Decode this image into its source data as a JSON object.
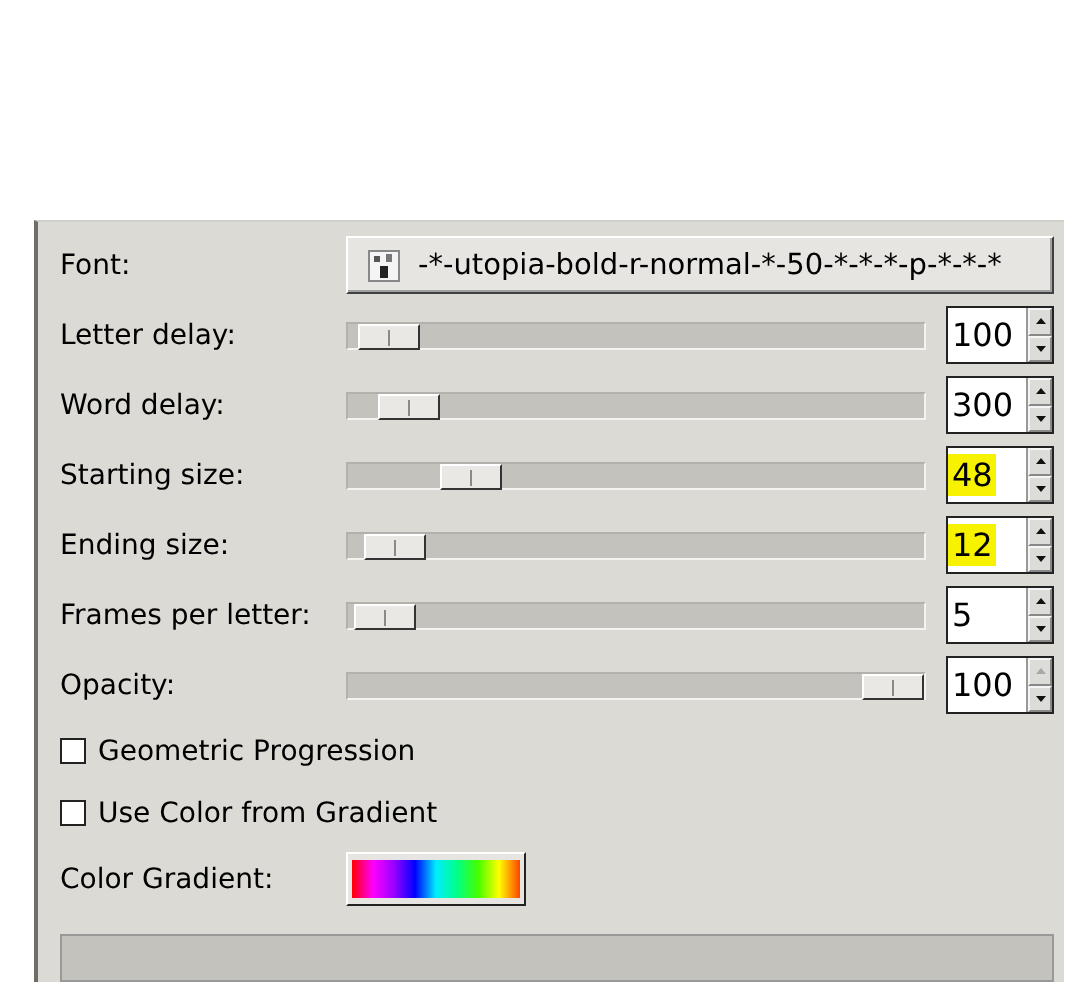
{
  "font": {
    "label": "Font:",
    "value": "-*-utopia-bold-r-normal-*-50-*-*-*-p-*-*-*"
  },
  "sliders": [
    {
      "label": "Letter delay:",
      "level": 0.02,
      "value": "100",
      "highlighted": false,
      "up_disabled": false
    },
    {
      "label": "Word delay:",
      "level": 0.06,
      "value": "300",
      "highlighted": false,
      "up_disabled": false
    },
    {
      "label": "Starting size:",
      "level": 0.18,
      "value": "48",
      "highlighted": true,
      "up_disabled": false
    },
    {
      "label": "Ending size:",
      "level": 0.03,
      "value": "12",
      "highlighted": true,
      "up_disabled": false
    },
    {
      "label": "Frames per letter:",
      "level": 0.01,
      "value": "5",
      "highlighted": false,
      "up_disabled": false
    },
    {
      "label": "Opacity:",
      "level": 1.0,
      "value": "100",
      "highlighted": false,
      "up_disabled": true
    }
  ],
  "checkboxes": [
    {
      "label": "Geometric Progression",
      "checked": false
    },
    {
      "label": "Use Color from Gradient",
      "checked": false
    }
  ],
  "gradient": {
    "label": "Color Gradient:"
  }
}
